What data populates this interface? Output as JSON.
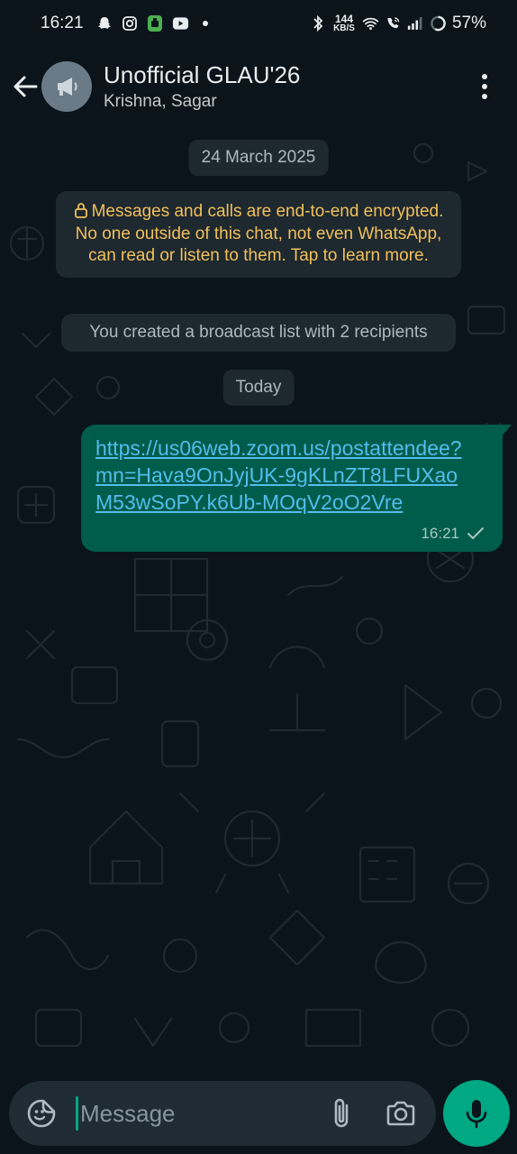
{
  "status_bar": {
    "time": "16:21",
    "notification_icons": [
      "snapchat-icon",
      "instagram-icon",
      "android-app-icon",
      "youtube-icon",
      "dot-icon"
    ],
    "network_speed_value": "144",
    "network_speed_unit": "KB/S",
    "battery": "57%"
  },
  "header": {
    "title": "Unofficial GLAU'26",
    "subtitle": "Krishna, Sagar"
  },
  "chat": {
    "date_chip_1": "24 March 2025",
    "encryption_notice": "Messages and calls are end-to-end encrypted. No one outside of this chat, not even WhatsApp, can read or listen to them. Tap to learn more.",
    "system_message": "You created a broadcast list with 2 recipients",
    "date_chip_2": "Today",
    "message": {
      "text": "https://us06web.zoom.us/postattendee?mn=Hava9OnJyjUK-9gKLnZT8LFUXaoM53wSoPY.k6Ub-MOqV2oO2Vre",
      "time": "16:21",
      "status": "sent"
    }
  },
  "composer": {
    "placeholder": "Message"
  },
  "colors": {
    "background": "#0b141a",
    "outgoing_bubble": "#005c4b",
    "link": "#53bdeb",
    "accent": "#00a884",
    "encryption_text": "#f2c05b"
  }
}
